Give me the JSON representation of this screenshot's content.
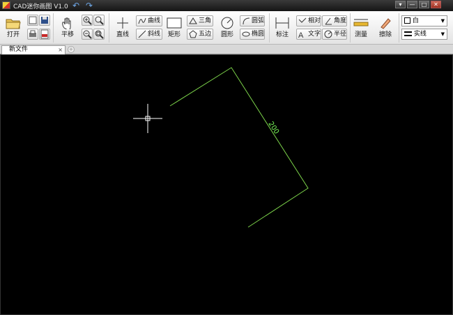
{
  "window": {
    "title": "CAD迷你画图 V1.0",
    "undo_icon": "undo-arrow-icon",
    "redo_icon": "redo-arrow-icon",
    "controls": [
      "▾",
      "—",
      "□",
      "✕"
    ]
  },
  "toolbar": {
    "open_label": "打开",
    "pan_label": "平移",
    "line_label": "直线",
    "curve_label": "曲线",
    "slant_label": "斜线",
    "rect_label": "矩形",
    "triangle_label": "三角",
    "pentagon_label": "五边",
    "circle_label": "圆形",
    "arc_label": "圆弧",
    "ellipse_label": "椭圆",
    "dimension_label": "标注",
    "relative_label": "相对",
    "angle_label": "角度",
    "text_label": "文字",
    "radius_label": "半径",
    "measure_label": "测量",
    "erase_label": "擦除",
    "color_value": "白",
    "linestyle_value": "实线"
  },
  "tabs": {
    "active_label": "新文件",
    "close_glyph": "×",
    "add_glyph": "+"
  },
  "drawing": {
    "dimension_text": "200",
    "line_color": "#7cd34a",
    "crosshair_color": "#ffffff"
  }
}
